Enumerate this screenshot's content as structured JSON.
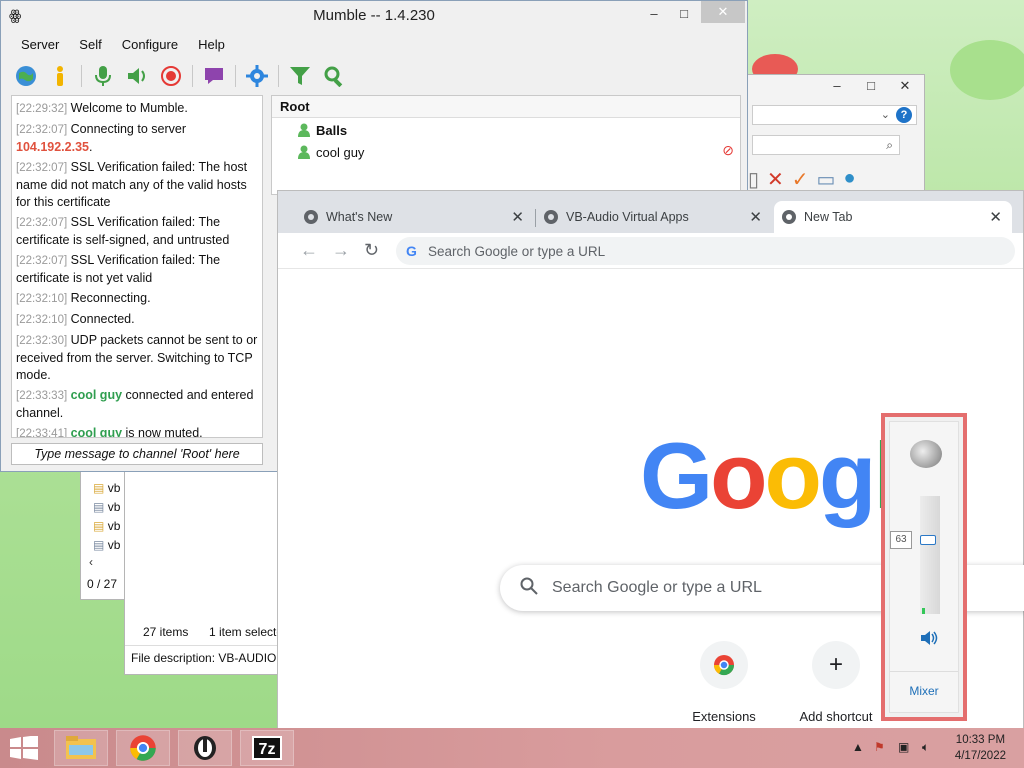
{
  "mumble": {
    "title": "Mumble -- 1.4.230",
    "window_controls": {
      "minimize": "–",
      "maximize": "□"
    },
    "menu": [
      "Server",
      "Self",
      "Configure",
      "Help"
    ],
    "log": [
      {
        "time": "[22:29:32]",
        "text": "Welcome to Mumble."
      },
      {
        "time": "[22:32:07]",
        "text": "Connecting to server",
        "highlight": "104.192.2.35",
        "after": "."
      },
      {
        "time": "[22:32:07]",
        "text": "SSL Verification failed: The host name did not match any of the valid hosts for this certificate"
      },
      {
        "time": "[22:32:07]",
        "text": "SSL Verification failed: The certificate is self-signed, and untrusted"
      },
      {
        "time": "[22:32:07]",
        "text": "SSL Verification failed: The certificate is not yet valid"
      },
      {
        "time": "[22:32:10]",
        "text": "Reconnecting."
      },
      {
        "time": "[22:32:10]",
        "text": "Connected."
      },
      {
        "time": "[22:32:30]",
        "text": "UDP packets cannot be sent to or received from the server. Switching to TCP mode."
      },
      {
        "time": "[22:33:33]",
        "user": "cool guy",
        "text": "connected and entered channel."
      },
      {
        "time": "[22:33:41]",
        "user": "cool guy",
        "text": "is now muted."
      }
    ],
    "message_placeholder": "Type message to channel 'Root' here",
    "channel_tree": {
      "root": "Root",
      "users": [
        "Balls",
        "cool guy"
      ]
    }
  },
  "explorer": {
    "items_count": "27 items",
    "selected": "1 item selecte",
    "file_description": "File description: VB-AUDIO",
    "list_items": [
      "vb",
      "vb",
      "vb",
      "vb"
    ],
    "status_left": "0 / 27 "
  },
  "chrome": {
    "tabs": [
      {
        "title": "What's New"
      },
      {
        "title": "VB-Audio Virtual Apps"
      },
      {
        "title": "New Tab",
        "active": true
      }
    ],
    "omnibox_placeholder": "Search Google or type a URL",
    "logo": "Googl",
    "search_placeholder": "Search Google or type a URL",
    "shortcuts": [
      "Extensions",
      "Add shortcut"
    ]
  },
  "volume_mixer": {
    "level": 63,
    "mixer_label": "Mixer"
  },
  "taskbar": {
    "time": "10:33 PM",
    "date": "4/17/2022"
  },
  "colors": {
    "mumble_user": "#2f9e4f",
    "mumble_ip": "#e0523e",
    "mixer_highlight": "#e46e6e",
    "taskbar": "#d99c9d"
  }
}
